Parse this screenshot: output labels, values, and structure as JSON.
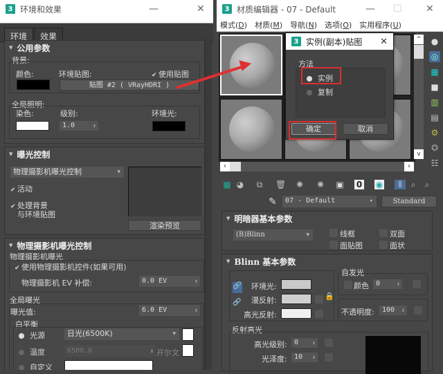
{
  "env_window": {
    "title": "环境和效果",
    "logo": "3",
    "tabs": [
      "环境",
      "效果"
    ],
    "common_params": {
      "header": "公用参数",
      "background_group": "背景:",
      "color_label": "颜色:",
      "env_map_label": "环境贴图:",
      "use_map_label": "使用贴图",
      "use_map_checked": true,
      "env_map_button": "贴图 #2  ( VRayHDRI )",
      "bg_color": "#000000",
      "global_lighting_group": "全局照明:",
      "tint_label": "染色:",
      "tint_color": "#ffffff",
      "level_label": "级别:",
      "level_value": "1.0",
      "ambient_label": "环境光:",
      "ambient_color": "#000000"
    },
    "exposure_control": {
      "header": "曝光控制",
      "type_selected": "物理摄影机曝光控制",
      "active_label": "活动",
      "active_checked": true,
      "process_bg_label_1": "处理背景",
      "process_bg_label_2": "与环境贴图",
      "process_bg_checked": true,
      "render_preview_button": "渲染预览"
    },
    "physical_camera_exposure": {
      "header": "物理摄影机曝光控制",
      "group": "物理摄影机曝光",
      "use_controls_label": "使用物理摄影机控件(如果可用)",
      "use_controls_checked": true,
      "ev_comp_label": "物理摄影机 EV 补偿:",
      "ev_comp_value": "0.0 EV",
      "global_exposure_group": "全局曝光",
      "exposure_value_label": "曝光值:",
      "exposure_value": "6.0 EV",
      "white_balance_group": "白平衡",
      "light_source_label": "光源",
      "light_source_selected": "日光(6500K)",
      "temperature_label": "温度",
      "temperature_value": "6500.0",
      "kelvin_label": "开尔文",
      "custom_label": "自定义",
      "white_balance_mode": "光源"
    }
  },
  "material_editor": {
    "title": "材质编辑器 - 07 - Default",
    "logo": "3",
    "menu": [
      {
        "label": "模式",
        "key": "D"
      },
      {
        "label": "材质",
        "key": "M"
      },
      {
        "label": "导航",
        "key": "N"
      },
      {
        "label": "选项",
        "key": "O"
      },
      {
        "label": "实用程序",
        "key": "U"
      }
    ],
    "material_name": "07 - Default",
    "material_type": "Standard",
    "shader_basic": {
      "header": "明暗器基本参数",
      "shader_selected": "(B)Blinn",
      "wire_label": "线框",
      "two_sided_label": "双面",
      "face_map_label": "面贴图",
      "faceted_label": "面状"
    },
    "blinn_basic": {
      "header": "Blinn 基本参数",
      "ambient_label": "环境光:",
      "diffuse_label": "漫反射:",
      "specular_label": "高光反射:",
      "self_illum_group": "自发光",
      "self_illum_color_label": "颜色",
      "self_illum_value": "0",
      "opacity_label": "不透明度:",
      "opacity_value": "100",
      "spec_highlights_group": "反射高光",
      "spec_level_label": "高光级别:",
      "spec_level_value": "0",
      "glossiness_label": "光泽度:",
      "glossiness_value": "10"
    }
  },
  "dialog": {
    "title": "实例(副本)贴图",
    "logo": "3",
    "method_group": "方法",
    "options": [
      "实例",
      "复制"
    ],
    "selected": "实例",
    "ok_button": "确定",
    "cancel_button": "取消"
  },
  "colors": {
    "annotation_red": "#d93030",
    "logo_teal": "#1aa18c",
    "panel_bg": "#444444"
  }
}
